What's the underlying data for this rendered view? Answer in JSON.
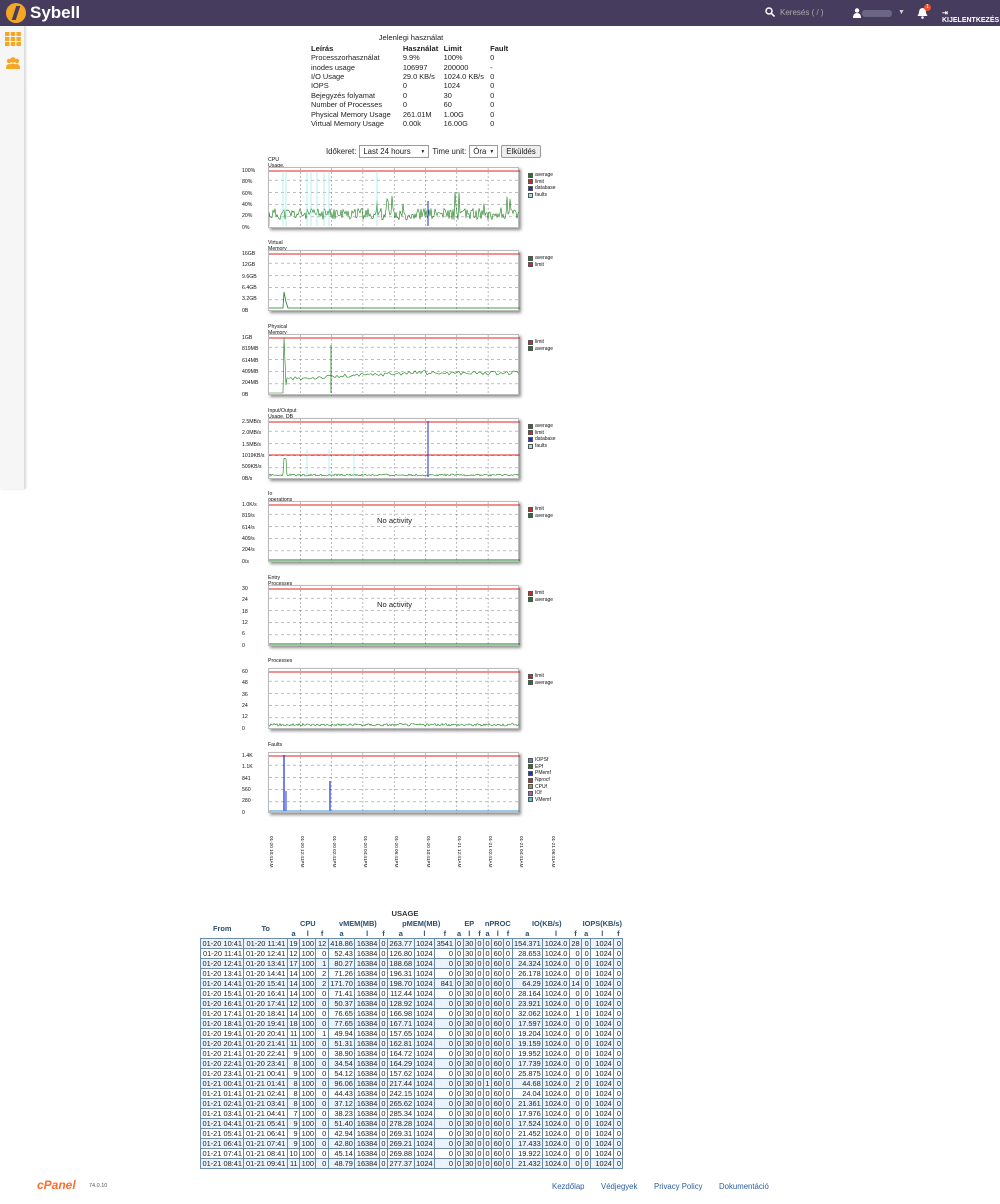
{
  "header": {
    "brand": "Sybell",
    "search_placeholder": "Keresés ( / )",
    "notification_count": "1",
    "logout_label": "KIJELENTKEZÉS",
    "accent": "#463d5e"
  },
  "summary": {
    "title": "Jelenlegi használat",
    "headers": [
      "Leírás",
      "Használat",
      "Limit",
      "Fault"
    ],
    "rows": [
      [
        "Processzorhasználat",
        "9.9%",
        "100%",
        "0"
      ],
      [
        "inodes usage",
        "106997",
        "200000",
        "-"
      ],
      [
        "I/O Usage",
        "29.0 KB/s",
        "1024.0 KB/s",
        "0"
      ],
      [
        "IOPS",
        "0",
        "1024",
        "0"
      ],
      [
        "Bejegyzés folyamat",
        "0",
        "30",
        "0"
      ],
      [
        "Number of Processes",
        "0",
        "60",
        "0"
      ],
      [
        "Physical Memory Usage",
        "261.01M",
        "1.00G",
        "0"
      ],
      [
        "Virtual Memory Usage",
        "0.00k",
        "16.00G",
        "0"
      ]
    ]
  },
  "form": {
    "label": "Időkeret:",
    "range": "Last 24 hours",
    "unit_label": "Time unit:",
    "unit": "Óra",
    "submit": "Elküldés"
  },
  "charts": [
    {
      "title": "CPU Usage. DB usage included, only if restricted",
      "yticks": [
        "100%",
        "80%",
        "60%",
        "40%",
        "20%",
        "0%"
      ],
      "legend": [
        [
          "average",
          "#1a7f1a"
        ],
        [
          "limit",
          "#e02020"
        ],
        [
          "database",
          "#1b2fd0"
        ],
        [
          "faults",
          "#8fe8e8"
        ]
      ],
      "no_activity": ""
    },
    {
      "title": "Virtual Memory Usage",
      "yticks": [
        "16GB",
        "12GB",
        "9.6GB",
        "6.4GB",
        "3.2GB",
        "0B"
      ],
      "legend": [
        [
          "average",
          "#1a7f1a"
        ],
        [
          "limit",
          "#e02020"
        ]
      ],
      "no_activity": ""
    },
    {
      "title": "Physical Memory Usage",
      "yticks": [
        "1GB",
        "819MB",
        "614MB",
        "409MB",
        "204MB",
        "0B"
      ],
      "legend": [
        [
          "limit",
          "#e02020"
        ],
        [
          "average",
          "#1a7f1a"
        ]
      ],
      "no_activity": ""
    },
    {
      "title": "Input/Output Usage. DB usage included, only if restricted",
      "yticks": [
        "2.5MB/s",
        "2.0MB/s",
        "1.5MB/s",
        "1019KB/s",
        "509KB/s",
        "0B/s"
      ],
      "legend": [
        [
          "average",
          "#1a7f1a"
        ],
        [
          "limit",
          "#e02020"
        ],
        [
          "database",
          "#1b2fd0"
        ],
        [
          "faults",
          "#8fe8e8"
        ]
      ],
      "no_activity": ""
    },
    {
      "title": "Io operations",
      "yticks": [
        "1.0K/s",
        "819/s",
        "614/s",
        "409/s",
        "204/s",
        "0/s"
      ],
      "legend": [
        [
          "limit",
          "#e02020"
        ],
        [
          "average",
          "#1a7f1a"
        ]
      ],
      "no_activity": "No activity"
    },
    {
      "title": "Entry Processes",
      "yticks": [
        "30",
        "24",
        "18",
        "12",
        "6",
        "0"
      ],
      "legend": [
        [
          "limit",
          "#e02020"
        ],
        [
          "average",
          "#1a7f1a"
        ]
      ],
      "no_activity": "No activity"
    },
    {
      "title": "Processes",
      "yticks": [
        "60",
        "48",
        "36",
        "24",
        "12",
        "0"
      ],
      "legend": [
        [
          "limit",
          "#e02020"
        ],
        [
          "average",
          "#1a7f1a"
        ]
      ],
      "no_activity": ""
    },
    {
      "title": "Faults",
      "yticks": [
        "1.4K",
        "1.1K",
        "841",
        "560",
        "280",
        "0"
      ],
      "legend": [
        [
          "IOPSf",
          "#3b8fd6"
        ],
        [
          "EPf",
          "#1a7f1a"
        ],
        [
          "PMemf",
          "#1b2fd0"
        ],
        [
          "Nprocf",
          "#e02020"
        ],
        [
          "CPUf",
          "#9a9a2a"
        ],
        [
          "IOf",
          "#a060c0"
        ],
        [
          "VMemf",
          "#3fc8e0"
        ]
      ],
      "no_activity": ""
    }
  ],
  "xticks": [
    "01-20 10:41AM",
    "01-20 12:41PM",
    "01-20 02:41PM",
    "01-20 04:41PM",
    "01-20 06:41PM",
    "01-20 10:41PM",
    "01-21 12:41AM",
    "01-21 02:41AM",
    "01-21 04:41AM",
    "01-21 06:41AM"
  ],
  "usage": {
    "caption": "USAGE",
    "groups": [
      "CPU",
      "vMEM(MB)",
      "pMEM(MB)",
      "EP",
      "nPROC",
      "IO(KB/s)",
      "IOPS(KB/s)"
    ],
    "from_label": "From",
    "to_label": "To",
    "sub": [
      "a",
      "l",
      "f",
      "a",
      "l",
      "f",
      "a",
      "l",
      "f",
      "a",
      "l",
      "f",
      "a",
      "l",
      "f",
      "a",
      "l",
      "f",
      "a",
      "l",
      "f"
    ],
    "rows": [
      [
        "01-20 10:41",
        "01-20 11:41",
        "19",
        "100",
        "12",
        "418.86",
        "16384",
        "0",
        "263.77",
        "1024",
        "3541",
        "0",
        "30",
        "0",
        "0",
        "60",
        "0",
        "154.371",
        "1024.0",
        "28",
        "0",
        "1024",
        "0"
      ],
      [
        "01-20 11:41",
        "01-20 12:41",
        "12",
        "100",
        "0",
        "52.43",
        "16384",
        "0",
        "126.80",
        "1024",
        "0",
        "0",
        "30",
        "0",
        "0",
        "60",
        "0",
        "28.653",
        "1024.0",
        "0",
        "0",
        "1024",
        "0"
      ],
      [
        "01-20 12:41",
        "01-20 13:41",
        "17",
        "100",
        "1",
        "80.27",
        "16384",
        "0",
        "188.68",
        "1024",
        "0",
        "0",
        "30",
        "0",
        "0",
        "60",
        "0",
        "24.324",
        "1024.0",
        "0",
        "0",
        "1024",
        "0"
      ],
      [
        "01-20 13:41",
        "01-20 14:41",
        "14",
        "100",
        "2",
        "71.26",
        "16384",
        "0",
        "196.31",
        "1024",
        "0",
        "0",
        "30",
        "0",
        "0",
        "60",
        "0",
        "26.178",
        "1024.0",
        "0",
        "0",
        "1024",
        "0"
      ],
      [
        "01-20 14:41",
        "01-20 15:41",
        "14",
        "100",
        "2",
        "171.70",
        "16384",
        "0",
        "198.70",
        "1024",
        "841",
        "0",
        "30",
        "0",
        "0",
        "60",
        "0",
        "64.29",
        "1024.0",
        "14",
        "0",
        "1024",
        "0"
      ],
      [
        "01-20 15:41",
        "01-20 16:41",
        "14",
        "100",
        "0",
        "71.41",
        "16384",
        "0",
        "112.44",
        "1024",
        "0",
        "0",
        "30",
        "0",
        "0",
        "60",
        "0",
        "28.164",
        "1024.0",
        "0",
        "0",
        "1024",
        "0"
      ],
      [
        "01-20 16:41",
        "01-20 17:41",
        "12",
        "100",
        "0",
        "50.37",
        "16384",
        "0",
        "128.92",
        "1024",
        "0",
        "0",
        "30",
        "0",
        "0",
        "60",
        "0",
        "23.921",
        "1024.0",
        "0",
        "0",
        "1024",
        "0"
      ],
      [
        "01-20 17:41",
        "01-20 18:41",
        "14",
        "100",
        "0",
        "76.65",
        "16384",
        "0",
        "166.98",
        "1024",
        "0",
        "0",
        "30",
        "0",
        "0",
        "60",
        "0",
        "32.062",
        "1024.0",
        "1",
        "0",
        "1024",
        "0"
      ],
      [
        "01-20 18:41",
        "01-20 19:41",
        "18",
        "100",
        "0",
        "77.65",
        "16384",
        "0",
        "167.71",
        "1024",
        "0",
        "0",
        "30",
        "0",
        "0",
        "60",
        "0",
        "17.597",
        "1024.0",
        "0",
        "0",
        "1024",
        "0"
      ],
      [
        "01-20 19:41",
        "01-20 20:41",
        "11",
        "100",
        "1",
        "49.94",
        "16384",
        "0",
        "157.65",
        "1024",
        "0",
        "0",
        "30",
        "0",
        "0",
        "60",
        "0",
        "19.204",
        "1024.0",
        "0",
        "0",
        "1024",
        "0"
      ],
      [
        "01-20 20:41",
        "01-20 21:41",
        "11",
        "100",
        "0",
        "51.31",
        "16384",
        "0",
        "162.81",
        "1024",
        "0",
        "0",
        "30",
        "0",
        "0",
        "60",
        "0",
        "19.159",
        "1024.0",
        "0",
        "0",
        "1024",
        "0"
      ],
      [
        "01-20 21:41",
        "01-20 22:41",
        "9",
        "100",
        "0",
        "38.90",
        "16384",
        "0",
        "164.72",
        "1024",
        "0",
        "0",
        "30",
        "0",
        "0",
        "60",
        "0",
        "19.952",
        "1024.0",
        "0",
        "0",
        "1024",
        "0"
      ],
      [
        "01-20 22:41",
        "01-20 23:41",
        "8",
        "100",
        "0",
        "34.54",
        "16384",
        "0",
        "164.29",
        "1024",
        "0",
        "0",
        "30",
        "0",
        "0",
        "60",
        "0",
        "17.739",
        "1024.0",
        "0",
        "0",
        "1024",
        "0"
      ],
      [
        "01-20 23:41",
        "01-21 00:41",
        "9",
        "100",
        "0",
        "54.12",
        "16384",
        "0",
        "157.62",
        "1024",
        "0",
        "0",
        "30",
        "0",
        "0",
        "60",
        "0",
        "25.875",
        "1024.0",
        "0",
        "0",
        "1024",
        "0"
      ],
      [
        "01-21 00:41",
        "01-21 01:41",
        "8",
        "100",
        "0",
        "96.06",
        "16384",
        "0",
        "217.44",
        "1024",
        "0",
        "0",
        "30",
        "0",
        "1",
        "60",
        "0",
        "44.68",
        "1024.0",
        "2",
        "0",
        "1024",
        "0"
      ],
      [
        "01-21 01:41",
        "01-21 02:41",
        "8",
        "100",
        "0",
        "44.43",
        "16384",
        "0",
        "242.15",
        "1024",
        "0",
        "0",
        "30",
        "0",
        "0",
        "60",
        "0",
        "24.04",
        "1024.0",
        "0",
        "0",
        "1024",
        "0"
      ],
      [
        "01-21 02:41",
        "01-21 03:41",
        "8",
        "100",
        "0",
        "37.12",
        "16384",
        "0",
        "265.62",
        "1024",
        "0",
        "0",
        "30",
        "0",
        "0",
        "60",
        "0",
        "21.361",
        "1024.0",
        "0",
        "0",
        "1024",
        "0"
      ],
      [
        "01-21 03:41",
        "01-21 04:41",
        "7",
        "100",
        "0",
        "38.23",
        "16384",
        "0",
        "285.34",
        "1024",
        "0",
        "0",
        "30",
        "0",
        "0",
        "60",
        "0",
        "17.976",
        "1024.0",
        "0",
        "0",
        "1024",
        "0"
      ],
      [
        "01-21 04:41",
        "01-21 05:41",
        "9",
        "100",
        "0",
        "51.40",
        "16384",
        "0",
        "278.28",
        "1024",
        "0",
        "0",
        "30",
        "0",
        "0",
        "60",
        "0",
        "17.524",
        "1024.0",
        "0",
        "0",
        "1024",
        "0"
      ],
      [
        "01-21 05:41",
        "01-21 06:41",
        "9",
        "100",
        "0",
        "42.94",
        "16384",
        "0",
        "269.31",
        "1024",
        "0",
        "0",
        "30",
        "0",
        "0",
        "60",
        "0",
        "21.452",
        "1024.0",
        "0",
        "0",
        "1024",
        "0"
      ],
      [
        "01-21 06:41",
        "01-21 07:41",
        "9",
        "100",
        "0",
        "42.80",
        "16384",
        "0",
        "269.21",
        "1024",
        "0",
        "0",
        "30",
        "0",
        "0",
        "60",
        "0",
        "17.433",
        "1024.0",
        "0",
        "0",
        "1024",
        "0"
      ],
      [
        "01-21 07:41",
        "01-21 08:41",
        "10",
        "100",
        "0",
        "45.14",
        "16384",
        "0",
        "269.88",
        "1024",
        "0",
        "0",
        "30",
        "0",
        "0",
        "60",
        "0",
        "19.922",
        "1024.0",
        "0",
        "0",
        "1024",
        "0"
      ],
      [
        "01-21 08:41",
        "01-21 09:41",
        "11",
        "100",
        "0",
        "48.79",
        "16384",
        "0",
        "277.37",
        "1024",
        "0",
        "0",
        "30",
        "0",
        "0",
        "60",
        "0",
        "21.432",
        "1024.0",
        "0",
        "0",
        "1024",
        "0"
      ]
    ]
  },
  "footer": {
    "brand": "cPanel",
    "version": "74.0.10",
    "links": [
      "Kezdőlap",
      "Védjegyek",
      "Privacy Policy",
      "Dokumentáció"
    ]
  }
}
